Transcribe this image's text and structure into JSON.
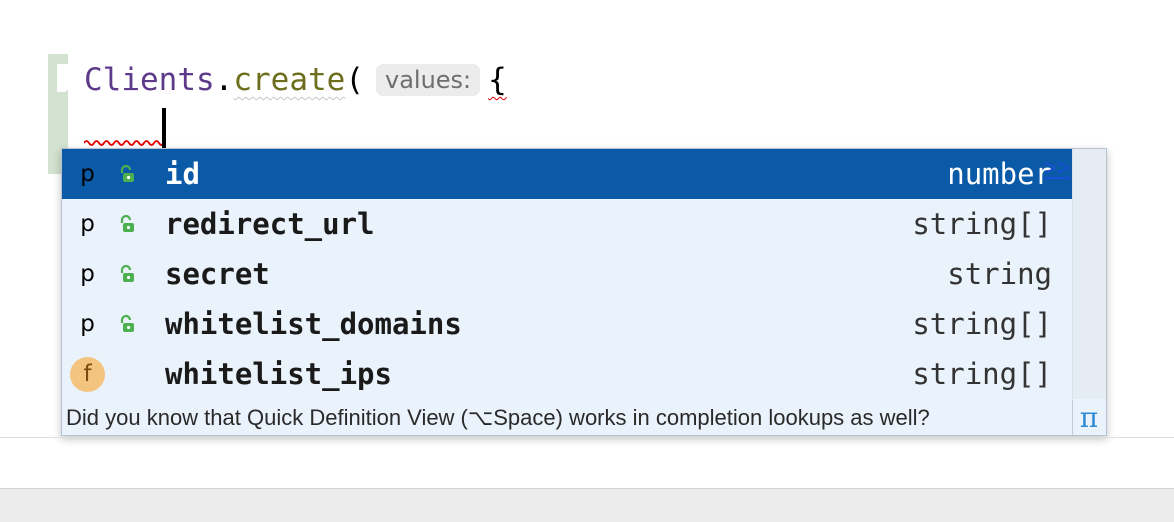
{
  "editor": {
    "code": {
      "class_name": "Clients",
      "dot": ".",
      "method_name": "create",
      "open_paren": "(",
      "param_hint": "values:",
      "open_brace": "{"
    }
  },
  "completion_popup": {
    "items": [
      {
        "kind": "p",
        "kind_icon": "property-icon",
        "visibility_icon": "public-lock-icon",
        "name": "id",
        "type": "number",
        "selected": true
      },
      {
        "kind": "p",
        "kind_icon": "property-icon",
        "visibility_icon": "public-lock-icon",
        "name": "redirect_url",
        "type": "string[]",
        "selected": false
      },
      {
        "kind": "p",
        "kind_icon": "property-icon",
        "visibility_icon": "public-lock-icon",
        "name": "secret",
        "type": "string",
        "selected": false
      },
      {
        "kind": "p",
        "kind_icon": "property-icon",
        "visibility_icon": "public-lock-icon",
        "name": "whitelist_domains",
        "type": "string[]",
        "selected": false
      },
      {
        "kind": "f",
        "kind_icon": "field-icon",
        "visibility_icon": "",
        "name": "whitelist_ips",
        "type": "string[]",
        "selected": false
      }
    ],
    "footer_tip": "Did you know that Quick Definition View (⌥Space) works in completion lookups as well?",
    "footer_link": ">>",
    "pi_symbol": "π"
  },
  "colors": {
    "selection": "#0a5aa8",
    "popup_background": "#eaf2fb",
    "class_purple": "#5d3a8a",
    "method_olive": "#6e6f1e",
    "error_red": "#e00000",
    "lock_green": "#4caf50"
  }
}
